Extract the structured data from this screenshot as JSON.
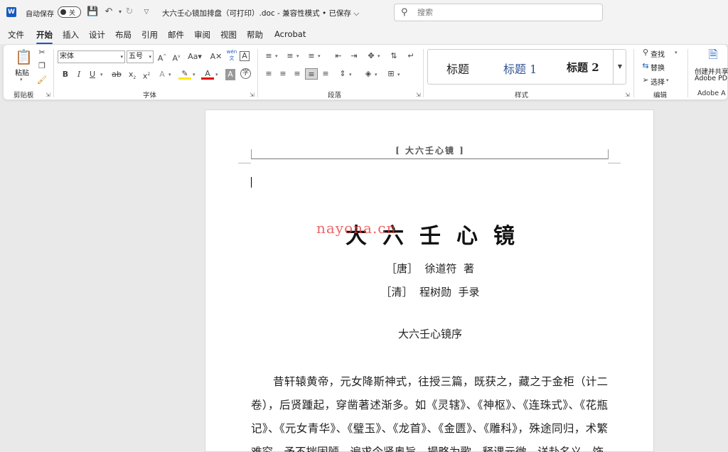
{
  "titlebar": {
    "autosave_label": "自动保存",
    "autosave_state": "关",
    "doc_title": "大六壬心镜加排盘（可打印）.doc  -  兼容性模式 • 已保存 ⌵",
    "search_placeholder": "搜索"
  },
  "tabs": [
    "文件",
    "开始",
    "插入",
    "设计",
    "布局",
    "引用",
    "邮件",
    "审阅",
    "视图",
    "帮助",
    "Acrobat"
  ],
  "active_tab": "开始",
  "ribbon": {
    "clipboard": {
      "paste_label": "粘贴",
      "group_label": "剪贴板"
    },
    "font": {
      "font_name": "宋体",
      "font_size": "五号",
      "group_label": "字体",
      "wen_top": "wén",
      "wen_char": "文"
    },
    "paragraph": {
      "group_label": "段落"
    },
    "styles": {
      "items": [
        "标题",
        "标题 1",
        "标题 2"
      ],
      "group_label": "样式"
    },
    "editing": {
      "find": "查找",
      "replace": "替换",
      "select": "选择",
      "group_label": "编辑"
    },
    "adobe": {
      "line1": "创建并共享",
      "line2": "Adobe PDF",
      "group_label": "Adobe A"
    }
  },
  "document": {
    "header_text": "[ 大六壬心镜 ]",
    "book_title": "大六壬心镜",
    "watermark": "nayona.cn",
    "author_lines": [
      "［唐］  徐道符  著",
      "［清］  程树勋  手录"
    ],
    "preface_title": "大六壬心镜序",
    "body": "昔轩辕黄帝，元女降斯神式，往授三篇，既获之，藏之于金柜（计二卷），后贤踵起，穿凿著述渐多。如《灵辖》、《神枢》、《连珠式》、《花瓶记》、《元女青华》、《璧玉》、《龙首》、《金匮》、《雕科》，殊途同归，术繁难究，予不揣固陋，遍求今贤奥旨，撮略为歌，释课元微，详赴名义，饰"
  },
  "colors": {
    "accent": "#185abd",
    "style_heading1": "#2f5496",
    "watermark": "#e63c3c",
    "highlight": "#ffe600",
    "font_color": "#e00000"
  }
}
